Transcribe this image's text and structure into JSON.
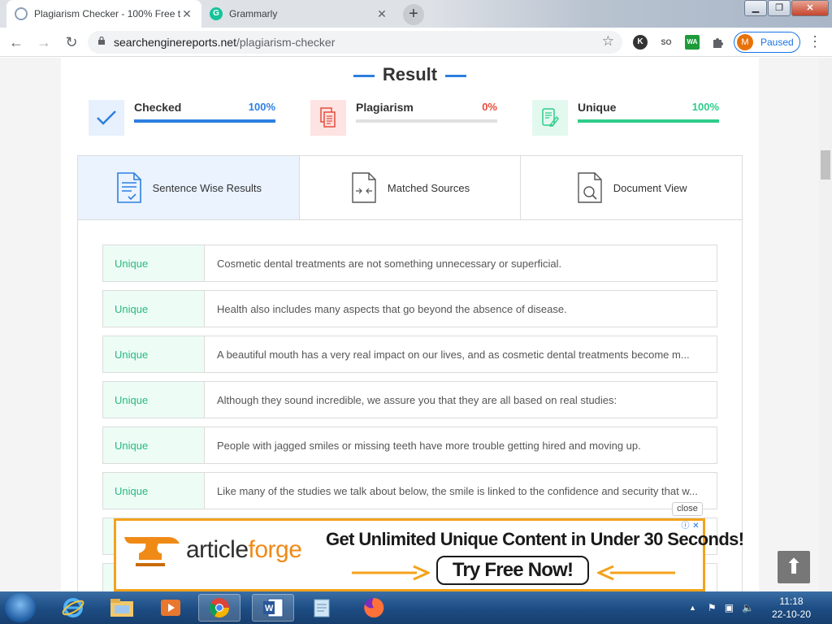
{
  "browser": {
    "tabs": [
      {
        "title": "Plagiarism Checker - 100% Free t",
        "active": true
      },
      {
        "title": "Grammarly",
        "active": false
      }
    ],
    "new_tab_label": "+",
    "url_domain": "searchenginereports.net",
    "url_path": "/plagiarism-checker",
    "profile_initial": "M",
    "profile_status": "Paused",
    "extensions": [
      "K",
      "SO",
      "WA",
      "puzzle-icon"
    ]
  },
  "result": {
    "title": "Result",
    "stats": [
      {
        "label": "Checked",
        "value": "100%",
        "fraction": 1.0,
        "color": "#2d7fe0"
      },
      {
        "label": "Plagiarism",
        "value": "0%",
        "fraction": 0.0,
        "color": "#e74c3c"
      },
      {
        "label": "Unique",
        "value": "100%",
        "fraction": 1.0,
        "color": "#2ecc8a"
      }
    ],
    "tabs": [
      {
        "label": "Sentence Wise Results",
        "active": true
      },
      {
        "label": "Matched Sources",
        "active": false
      },
      {
        "label": "Document View",
        "active": false
      }
    ],
    "rows": [
      {
        "status": "Unique",
        "text": "Cosmetic dental treatments are not something unnecessary or superficial."
      },
      {
        "status": "Unique",
        "text": "Health also includes many aspects that go beyond the absence of disease."
      },
      {
        "status": "Unique",
        "text": "A beautiful mouth has a very real impact on our lives, and as cosmetic dental treatments become m..."
      },
      {
        "status": "Unique",
        "text": "Although they sound incredible, we assure you that they are all based on real studies:"
      },
      {
        "status": "Unique",
        "text": "People with jagged smiles or missing teeth have more trouble getting hired and moving up."
      },
      {
        "status": "Unique",
        "text": "Like many of the studies we talk about below, the smile is linked to the confidence and security that w..."
      },
      {
        "status": "",
        "text": ""
      },
      {
        "status": "",
        "text": ""
      }
    ]
  },
  "ad": {
    "close_label": "close",
    "brand_prefix": "article",
    "brand_suffix": "forge",
    "headline": "Get Unlimited Unique Content in Under 30 Seconds!",
    "cta": "Try Free Now!",
    "accent": "#f3a21b"
  },
  "taskbar": {
    "time": "11:18",
    "date": "22-10-20"
  }
}
